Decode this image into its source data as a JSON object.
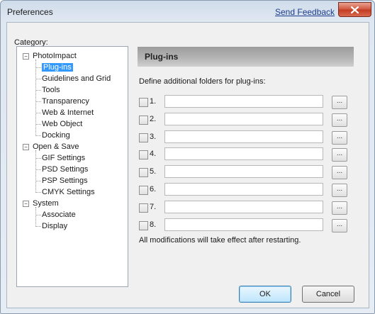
{
  "window": {
    "title": "Preferences",
    "feedback_link": "Send Feedback",
    "close_icon": "close-icon"
  },
  "category": {
    "label": "Category:",
    "tree": [
      {
        "label": "PhotoImpact",
        "type": "group",
        "expanded": true
      },
      {
        "label": "Plug-ins",
        "type": "item",
        "selected": true
      },
      {
        "label": "Guidelines and Grid",
        "type": "item"
      },
      {
        "label": "Tools",
        "type": "item"
      },
      {
        "label": "Transparency",
        "type": "item"
      },
      {
        "label": "Web & Internet",
        "type": "item"
      },
      {
        "label": "Web Object",
        "type": "item"
      },
      {
        "label": "Docking",
        "type": "item"
      },
      {
        "label": "Open & Save",
        "type": "group",
        "expanded": true
      },
      {
        "label": "GIF Settings",
        "type": "item"
      },
      {
        "label": "PSD Settings",
        "type": "item"
      },
      {
        "label": "PSP Settings",
        "type": "item"
      },
      {
        "label": "CMYK Settings",
        "type": "item"
      },
      {
        "label": "System",
        "type": "group",
        "expanded": true
      },
      {
        "label": "Associate",
        "type": "item"
      },
      {
        "label": "Display",
        "type": "item"
      }
    ]
  },
  "panel": {
    "header": "Plug-ins",
    "description": "Define additional folders for plug-ins:",
    "folders": [
      {
        "num": "1.",
        "value": "",
        "checked": false,
        "browse": "..."
      },
      {
        "num": "2.",
        "value": "",
        "checked": false,
        "browse": "..."
      },
      {
        "num": "3.",
        "value": "",
        "checked": false,
        "browse": "..."
      },
      {
        "num": "4.",
        "value": "",
        "checked": false,
        "browse": "..."
      },
      {
        "num": "5.",
        "value": "",
        "checked": false,
        "browse": "..."
      },
      {
        "num": "6.",
        "value": "",
        "checked": false,
        "browse": "..."
      },
      {
        "num": "7.",
        "value": "",
        "checked": false,
        "browse": "..."
      },
      {
        "num": "8.",
        "value": "",
        "checked": false,
        "browse": "..."
      }
    ],
    "note": "All modifications will take effect after restarting."
  },
  "buttons": {
    "ok": "OK",
    "cancel": "Cancel"
  },
  "colors": {
    "selection": "#3399ff",
    "close_button": "#c23a22",
    "link": "#1a3c8a"
  }
}
